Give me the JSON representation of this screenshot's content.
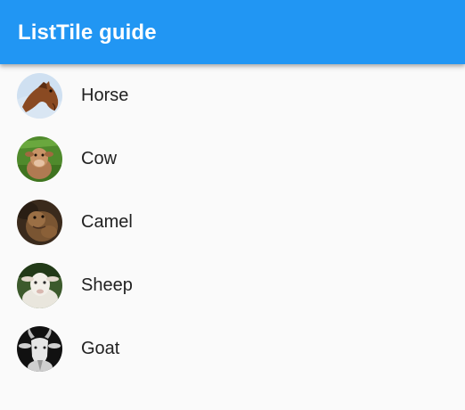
{
  "app_bar": {
    "title": "ListTile guide"
  },
  "animals": [
    {
      "label": "Horse",
      "icon": "horse-avatar"
    },
    {
      "label": "Cow",
      "icon": "cow-avatar"
    },
    {
      "label": "Camel",
      "icon": "camel-avatar"
    },
    {
      "label": "Sheep",
      "icon": "sheep-avatar"
    },
    {
      "label": "Goat",
      "icon": "goat-avatar"
    }
  ],
  "colors": {
    "app_bar": "#2196f3",
    "background": "#fafafa",
    "text": "#212121"
  }
}
